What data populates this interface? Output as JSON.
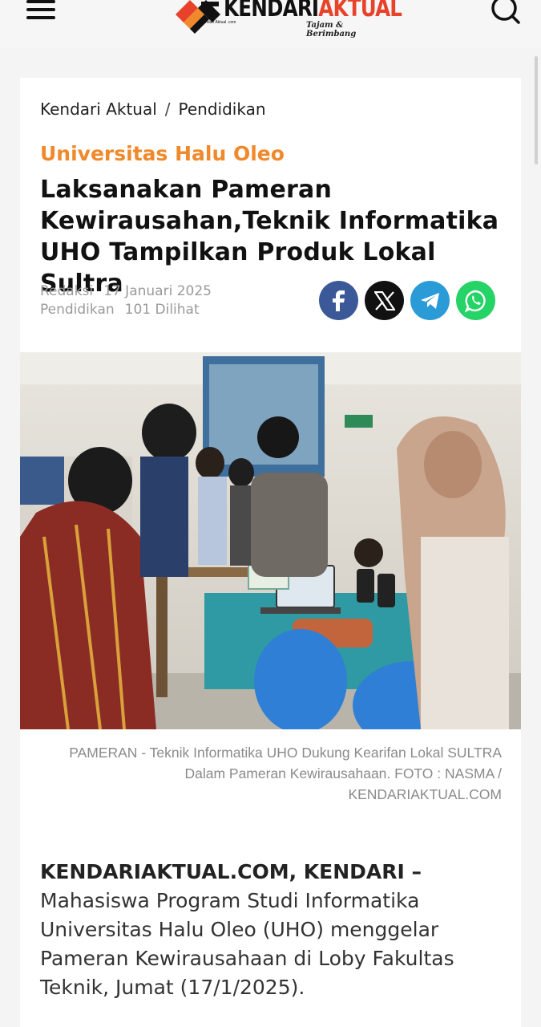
{
  "header": {
    "menu_icon": "hamburger-icon",
    "logo_main_1": "KENDARI",
    "logo_main_2": "AKTUAL",
    "logo_tagline": "Tajam & Berimbang",
    "logo_small": "Kendari Aktual .com",
    "search_icon": "search-icon"
  },
  "breadcrumb": {
    "home": "Kendari Aktual",
    "separator": "/",
    "current": "Pendidikan"
  },
  "article": {
    "category": "Universitas Halu Oleo",
    "title": "Laksanakan Pameran Kewirausahan,Teknik Informatika UHO Tampilkan Produk Lokal Sultra",
    "author": "Redaksi",
    "date": "17 Januari 2025",
    "section": "Pendidikan",
    "views": "101 Dilihat",
    "caption": "PAMERAN - Teknik Informatika UHO Dukung Kearifan Lokal SULTRA Dalam Pameran Kewirausahaan. FOTO : NASMA / KENDARIAKTUAL.COM",
    "lead_bold": "KENDARIAKTUAL.COM, KENDARI",
    "lead_dash": " –",
    "lead_text": " Mahasiswa Program Studi Informatika Universitas Halu Oleo (UHO) menggelar Pameran Kewirausahaan di Loby Fakultas Teknik, Jumat (17/1/2025)."
  },
  "share": {
    "facebook_icon": "facebook-icon",
    "x_icon": "x-icon",
    "telegram_icon": "telegram-icon",
    "whatsapp_icon": "whatsapp-icon"
  },
  "colors": {
    "category": "#f0892b",
    "facebook": "#3b5998",
    "x": "#111111",
    "telegram": "#2a9bd7",
    "whatsapp": "#25d366",
    "logo_accent": "#e8432a"
  }
}
